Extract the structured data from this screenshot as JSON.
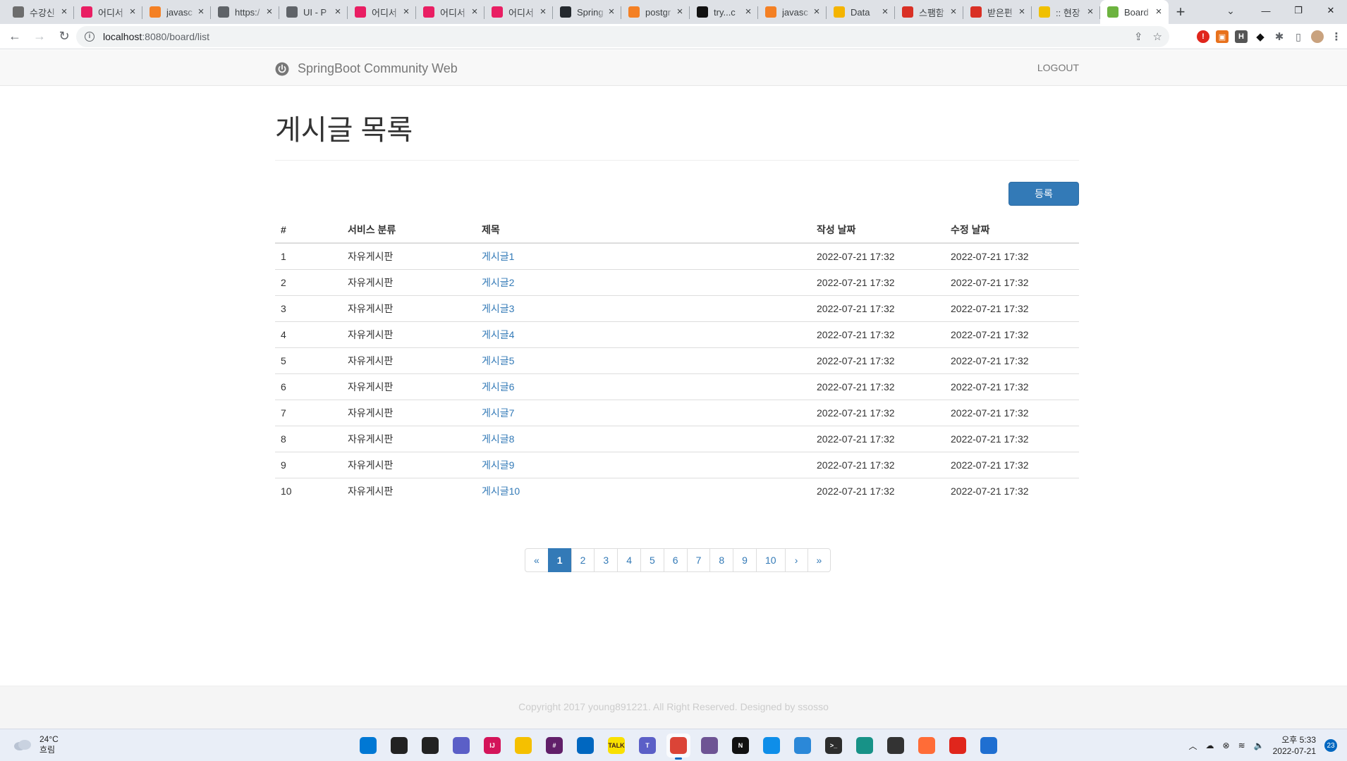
{
  "browser": {
    "tabs": [
      {
        "label": "수강신",
        "color": "#6d6d6d"
      },
      {
        "label": "어디서",
        "color": "#e91e63"
      },
      {
        "label": "javasc",
        "color": "#f48024"
      },
      {
        "label": "https:/",
        "color": "#5f6368"
      },
      {
        "label": "UI - P",
        "color": "#5f6368"
      },
      {
        "label": "어디서",
        "color": "#e91e63"
      },
      {
        "label": "어디서",
        "color": "#e91e63"
      },
      {
        "label": "어디서",
        "color": "#e91e63"
      },
      {
        "label": "Spring",
        "color": "#24292e"
      },
      {
        "label": "postgr",
        "color": "#f48024"
      },
      {
        "label": "try...c",
        "color": "#111111"
      },
      {
        "label": "javasc",
        "color": "#f48024"
      },
      {
        "label": "Data",
        "color": "#f4b400"
      },
      {
        "label": "스팸함",
        "color": "#d93025"
      },
      {
        "label": "받은편",
        "color": "#d93025"
      },
      {
        "label": ":: 현장",
        "color": "#f0c000"
      },
      {
        "label": "Board",
        "color": "#6db33f"
      }
    ],
    "new_tab": "+",
    "url_host": "localhost",
    "url_rest": ":8080/board/list"
  },
  "navbar": {
    "brand": "SpringBoot Community Web",
    "logout": "LOGOUT"
  },
  "main": {
    "title": "게시글 목록",
    "register_button": "등록",
    "table": {
      "headers": [
        "#",
        "서비스 분류",
        "제목",
        "작성 날짜",
        "수정 날짜"
      ],
      "rows": [
        {
          "idx": "1",
          "category": "자유게시판",
          "title": "게시글1",
          "created": "2022-07-21 17:32",
          "updated": "2022-07-21 17:32"
        },
        {
          "idx": "2",
          "category": "자유게시판",
          "title": "게시글2",
          "created": "2022-07-21 17:32",
          "updated": "2022-07-21 17:32"
        },
        {
          "idx": "3",
          "category": "자유게시판",
          "title": "게시글3",
          "created": "2022-07-21 17:32",
          "updated": "2022-07-21 17:32"
        },
        {
          "idx": "4",
          "category": "자유게시판",
          "title": "게시글4",
          "created": "2022-07-21 17:32",
          "updated": "2022-07-21 17:32"
        },
        {
          "idx": "5",
          "category": "자유게시판",
          "title": "게시글5",
          "created": "2022-07-21 17:32",
          "updated": "2022-07-21 17:32"
        },
        {
          "idx": "6",
          "category": "자유게시판",
          "title": "게시글6",
          "created": "2022-07-21 17:32",
          "updated": "2022-07-21 17:32"
        },
        {
          "idx": "7",
          "category": "자유게시판",
          "title": "게시글7",
          "created": "2022-07-21 17:32",
          "updated": "2022-07-21 17:32"
        },
        {
          "idx": "8",
          "category": "자유게시판",
          "title": "게시글8",
          "created": "2022-07-21 17:32",
          "updated": "2022-07-21 17:32"
        },
        {
          "idx": "9",
          "category": "자유게시판",
          "title": "게시글9",
          "created": "2022-07-21 17:32",
          "updated": "2022-07-21 17:32"
        },
        {
          "idx": "10",
          "category": "자유게시판",
          "title": "게시글10",
          "created": "2022-07-21 17:32",
          "updated": "2022-07-21 17:32"
        }
      ]
    },
    "pagination": [
      "«",
      "1",
      "2",
      "3",
      "4",
      "5",
      "6",
      "7",
      "8",
      "9",
      "10",
      "›",
      "»"
    ],
    "active_page": "1"
  },
  "footer": {
    "text": "Copyright 2017 young891221. All Right Reserved. Designed by ssosso"
  },
  "taskbar": {
    "weather_temp": "24°C",
    "weather_desc": "흐림",
    "apps": [
      {
        "name": "start",
        "glyph": "",
        "color": "#0078d4"
      },
      {
        "name": "search",
        "glyph": "",
        "color": "#222222"
      },
      {
        "name": "task-view",
        "glyph": "",
        "color": "#222222"
      },
      {
        "name": "chat",
        "glyph": "",
        "color": "#5b5fc7"
      },
      {
        "name": "intellij",
        "glyph": "IJ",
        "color": "#d4145a"
      },
      {
        "name": "explorer",
        "glyph": "",
        "color": "#f5c000"
      },
      {
        "name": "slack",
        "glyph": "#",
        "color": "#611f69"
      },
      {
        "name": "store",
        "glyph": "",
        "color": "#0067c0"
      },
      {
        "name": "kakaotalk",
        "glyph": "TALK",
        "color": "#f9e000"
      },
      {
        "name": "teams",
        "glyph": "T",
        "color": "#5b5fc7"
      },
      {
        "name": "chrome",
        "glyph": "",
        "color": "#db4437"
      },
      {
        "name": "github-desktop",
        "glyph": "",
        "color": "#6e5494"
      },
      {
        "name": "notion",
        "glyph": "N",
        "color": "#111111"
      },
      {
        "name": "teamviewer",
        "glyph": "",
        "color": "#0e8ee9"
      },
      {
        "name": "notepad",
        "glyph": "",
        "color": "#2b88d8"
      },
      {
        "name": "terminal",
        "glyph": ">_",
        "color": "#2d2d2d"
      },
      {
        "name": "gitkraken",
        "glyph": "",
        "color": "#179287"
      },
      {
        "name": "linux",
        "glyph": "",
        "color": "#333333"
      },
      {
        "name": "postman",
        "glyph": "",
        "color": "#ff6c37"
      },
      {
        "name": "acrobat",
        "glyph": "",
        "color": "#e0261c"
      },
      {
        "name": "photos",
        "glyph": "",
        "color": "#1f6fd1"
      }
    ],
    "clock_ampm_time": "오후 5:33",
    "clock_date": "2022-07-21",
    "notifications": "23"
  }
}
